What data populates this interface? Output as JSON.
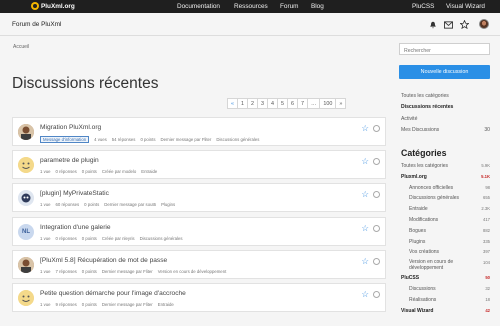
{
  "topnav": {
    "logo": "PluXml.org",
    "links": [
      "Documentation",
      "Ressources",
      "Forum",
      "Blog",
      "PluCSS",
      "Visual Wizard"
    ]
  },
  "subbar": {
    "title": "Forum de PluXml",
    "icons": [
      "bell-icon",
      "mail-icon",
      "star-icon",
      "avatar"
    ]
  },
  "breadcrumb": "Accueil",
  "page_title": "Discussions récentes",
  "pager": [
    "«",
    "1",
    "2",
    "3",
    "4",
    "5",
    "6",
    "7",
    "…",
    "100",
    "»"
  ],
  "topics": [
    {
      "title": "Migration PluXml.org",
      "avatar": "photo",
      "badge": "Message d'information",
      "meta": [
        "4 vues",
        "54 réponses",
        "0 points",
        "Dernier message par Fliter",
        "Discussions générales"
      ]
    },
    {
      "title": "parametre de plugin",
      "avatar": "smiley",
      "meta": [
        "1 vue",
        "0 réponses",
        "0 points",
        "Créée par modelo",
        "Entraide"
      ]
    },
    {
      "title": "[plugin] MyPrivateStatic",
      "avatar": "robot",
      "meta": [
        "1 vue",
        "60 réponses",
        "0 points",
        "Dernier message par sout6",
        "Plugins"
      ]
    },
    {
      "title": "Integration d'une galerie",
      "avatar": "NL",
      "meta": [
        "1 vue",
        "0 réponses",
        "0 points",
        "Créée par nleyris",
        "Discussions générales"
      ]
    },
    {
      "title": "[PluXml 5.8] Récupération de mot de passe",
      "avatar": "photo",
      "meta": [
        "1 vue",
        "7 réponses",
        "0 points",
        "Dernier message par Fliter",
        "Version en cours de développement"
      ]
    },
    {
      "title": "Petite question démarche pour l'image d'accroche",
      "avatar": "smiley",
      "meta": [
        "1 vue",
        "9 réponses",
        "0 points",
        "Dernier message par Fliter",
        "Entraide"
      ]
    }
  ],
  "sidebar": {
    "search_placeholder": "Rechercher",
    "new_button": "Nouvelle discussion",
    "links": [
      {
        "label": "Toutes les catégories",
        "count": ""
      },
      {
        "label": "Discussions récentes",
        "count": "",
        "active": true
      },
      {
        "label": "Activité",
        "count": ""
      },
      {
        "label": "Mes Discussions",
        "count": "30"
      }
    ],
    "categories_title": "Catégories",
    "categories": [
      {
        "label": "Toutes les catégories",
        "count": "5.9K",
        "kind": "top"
      },
      {
        "label": "Pluxml.org",
        "count": "5.1K",
        "kind": "main"
      },
      {
        "label": "Annonces officielles",
        "count": "98",
        "kind": "sub"
      },
      {
        "label": "Discussions générales",
        "count": "655",
        "kind": "sub"
      },
      {
        "label": "Entraide",
        "count": "2.3K",
        "kind": "sub"
      },
      {
        "label": "Modifications",
        "count": "417",
        "kind": "sub"
      },
      {
        "label": "Bogues",
        "count": "882",
        "kind": "sub"
      },
      {
        "label": "Plugins",
        "count": "335",
        "kind": "sub"
      },
      {
        "label": "Vos créations",
        "count": "397",
        "kind": "sub"
      },
      {
        "label": "Version en cours de développement",
        "count": "104",
        "kind": "sub-tall"
      },
      {
        "label": "PluCSS",
        "count": "50",
        "kind": "main"
      },
      {
        "label": "Discussions",
        "count": "32",
        "kind": "sub"
      },
      {
        "label": "Réalisations",
        "count": "18",
        "kind": "sub"
      },
      {
        "label": "Visual Wizard",
        "count": "42",
        "kind": "main"
      }
    ]
  }
}
